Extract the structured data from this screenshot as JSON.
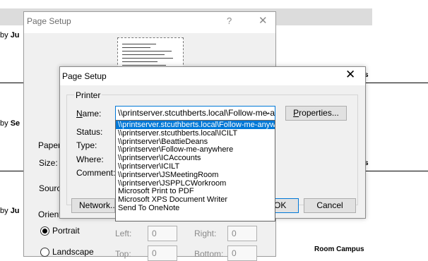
{
  "background": {
    "entries": [
      {
        "prefix": "by",
        "name": "Ju"
      },
      {
        "prefix": "by",
        "name": "Se"
      },
      {
        "prefix": "by",
        "name": "Ju"
      }
    ],
    "right_labels": [
      "s",
      "s",
      "Room Campus"
    ]
  },
  "outer_dialog": {
    "title": "Page Setup",
    "help": "?",
    "close": "✕",
    "paper_group": "Paper",
    "size_label": "Size:",
    "source_label": "Sourc",
    "orientation_group": "Orient",
    "portrait_label": "Portrait",
    "landscape_label": "Landscape",
    "portrait_checked": true,
    "margins": {
      "left_label": "Left:",
      "right_label": "Right:",
      "top_label": "Top:",
      "bottom_label": "Bottom:",
      "left_value": "0",
      "right_value": "0",
      "top_value": "0",
      "bottom_value": "0"
    }
  },
  "main_dialog": {
    "title": "Page Setup",
    "close": "✕",
    "printer_group": "Printer",
    "name_label": "Name:",
    "status_label": "Status:",
    "type_label": "Type:",
    "where_label": "Where:",
    "comment_label": "Comment:",
    "name_value": "\\\\printserver.stcuthberts.local\\Follow-me-anywhere",
    "properties_button": "Properties...",
    "network_button": "Network...",
    "ok_button": "OK",
    "cancel_button": "Cancel"
  },
  "dropdown": {
    "items": [
      "\\\\printserver.stcuthberts.local\\Follow-me-anywhere",
      "\\\\printserver.stcuthberts.local\\ICILT",
      "\\\\printserver\\BeattieDeans",
      "\\\\printserver\\Follow-me-anywhere",
      "\\\\printserver\\ICAccounts",
      "\\\\printserver\\ICILT",
      "\\\\printserver\\JSMeetingRoom",
      "\\\\printserver\\JSPPLCWorkroom",
      "Microsoft Print to PDF",
      "Microsoft XPS Document Writer",
      "Send To OneNote"
    ],
    "selected_index": 0
  },
  "colors": {
    "accent": "#0078d7",
    "dialog_bg": "#f0f0f0",
    "button_bg": "#e1e1e1"
  }
}
